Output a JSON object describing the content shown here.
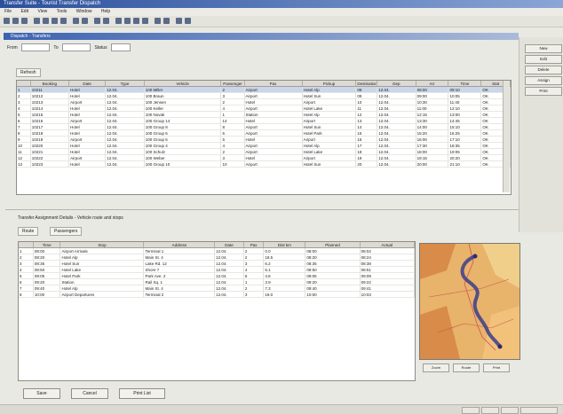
{
  "window": {
    "title": "Transfer Suite - Tourist Transfer Dispatch"
  },
  "menu": [
    "File",
    "Edit",
    "View",
    "Tools",
    "Window",
    "Help"
  ],
  "document": {
    "title": "Dispatch - Transfers"
  },
  "filter": {
    "from_label": "From",
    "to_label": "To",
    "from_value": "",
    "to_value": "",
    "status_label": "Status",
    "status_value": ""
  },
  "upper": {
    "button": "Refresh",
    "columns": [
      "",
      "Booking",
      "Date",
      "Type",
      "Vehicle",
      "Passenger",
      "Pax",
      "Pickup",
      "Destination",
      "Dep",
      "Arr",
      "Time",
      "Stat"
    ],
    "rows": [
      [
        "1",
        "10211",
        "Hotel",
        "12.04.",
        "100 Miller",
        "2",
        "Airport",
        "Hotel Alp",
        "08",
        "12.04.",
        "08:00",
        "09:10",
        "OK"
      ],
      [
        "2",
        "10212",
        "Hotel",
        "12.04.",
        "100 Braun",
        "3",
        "Airport",
        "Hotel Sun",
        "09",
        "12.04.",
        "09:00",
        "10:05",
        "OK"
      ],
      [
        "3",
        "10213",
        "Airport",
        "12.04.",
        "100 Jensen",
        "2",
        "Hotel",
        "Airport",
        "10",
        "12.04.",
        "10:30",
        "11:40",
        "OK"
      ],
      [
        "4",
        "10214",
        "Hotel",
        "12.04.",
        "100 Keller",
        "4",
        "Airport",
        "Hotel Lake",
        "11",
        "12.04.",
        "11:00",
        "12:10",
        "OK"
      ],
      [
        "5",
        "10215",
        "Hotel",
        "12.04.",
        "100 Novak",
        "1",
        "Station",
        "Hotel Alp",
        "12",
        "12.04.",
        "12:15",
        "13:00",
        "OK"
      ],
      [
        "6",
        "10216",
        "Airport",
        "12.04.",
        "100 Group 14",
        "14",
        "Hotel",
        "Airport",
        "13",
        "12.04.",
        "13:30",
        "14:45",
        "OK"
      ],
      [
        "7",
        "10217",
        "Hotel",
        "12.04.",
        "100 Group 8",
        "8",
        "Airport",
        "Hotel Sun",
        "14",
        "12.04.",
        "14:00",
        "15:10",
        "OK"
      ],
      [
        "8",
        "10218",
        "Hotel",
        "12.04.",
        "100 Group 6",
        "6",
        "Airport",
        "Hotel Park",
        "15",
        "12.04.",
        "15:20",
        "16:25",
        "OK"
      ],
      [
        "9",
        "10219",
        "Airport",
        "12.04.",
        "100 Group 5",
        "5",
        "Hotel",
        "Airport",
        "16",
        "12.04.",
        "16:00",
        "17:10",
        "OK"
      ],
      [
        "10",
        "10220",
        "Hotel",
        "12.04.",
        "100 Group 4",
        "4",
        "Airport",
        "Hotel Alp",
        "17",
        "12.04.",
        "17:30",
        "18:35",
        "OK"
      ],
      [
        "11",
        "10221",
        "Hotel",
        "12.04.",
        "100 Schulz",
        "2",
        "Airport",
        "Hotel Lake",
        "18",
        "12.04.",
        "18:00",
        "19:05",
        "OK"
      ],
      [
        "12",
        "10222",
        "Airport",
        "12.04.",
        "100 Weber",
        "3",
        "Hotel",
        "Airport",
        "19",
        "12.04.",
        "19:15",
        "20:20",
        "OK"
      ],
      [
        "13",
        "10223",
        "Hotel",
        "12.04.",
        "100 Group 10",
        "10",
        "Airport",
        "Hotel Sun",
        "20",
        "12.04.",
        "20:00",
        "21:10",
        "OK"
      ]
    ]
  },
  "side_buttons": [
    "New",
    "Edit",
    "Delete",
    "Assign",
    "Print"
  ],
  "lower": {
    "info": "Transfer Assignment Details - Vehicle route and stops",
    "tab1": "Route",
    "tab2": "Passengers",
    "columns": [
      "",
      "Time",
      "Stop",
      "Address",
      "Date",
      "Pax",
      "Dist km",
      "Planned",
      "Actual"
    ],
    "rows": [
      [
        "1",
        "08:00",
        "Airport Arrivals",
        "Terminal 1",
        "12.04.",
        "2",
        "0.0",
        "08:00",
        "08:02"
      ],
      [
        "2",
        "08:20",
        "Hotel Alp",
        "Main St. 4",
        "12.04.",
        "2",
        "18.5",
        "08:20",
        "08:24"
      ],
      [
        "3",
        "08:35",
        "Hotel Sun",
        "Lake Rd. 12",
        "12.04.",
        "3",
        "6.2",
        "08:35",
        "08:38"
      ],
      [
        "4",
        "08:50",
        "Hotel Lake",
        "Shore 7",
        "12.04.",
        "4",
        "5.1",
        "08:50",
        "08:51"
      ],
      [
        "5",
        "09:05",
        "Hotel Park",
        "Park Ave. 2",
        "12.04.",
        "6",
        "4.8",
        "09:05",
        "09:09"
      ],
      [
        "6",
        "09:20",
        "Station",
        "Rail Sq. 1",
        "12.04.",
        "1",
        "3.9",
        "09:20",
        "09:22"
      ],
      [
        "7",
        "09:40",
        "Hotel Alp",
        "Main St. 4",
        "12.04.",
        "2",
        "7.3",
        "09:40",
        "09:41"
      ],
      [
        "8",
        "10:00",
        "Airport Departures",
        "Terminal 2",
        "12.04.",
        "3",
        "19.0",
        "10:00",
        "10:03"
      ]
    ]
  },
  "map_buttons": [
    "Zoom",
    "Route",
    "Print"
  ],
  "bottom_buttons": [
    "Save",
    "Cancel",
    "Print List"
  ]
}
